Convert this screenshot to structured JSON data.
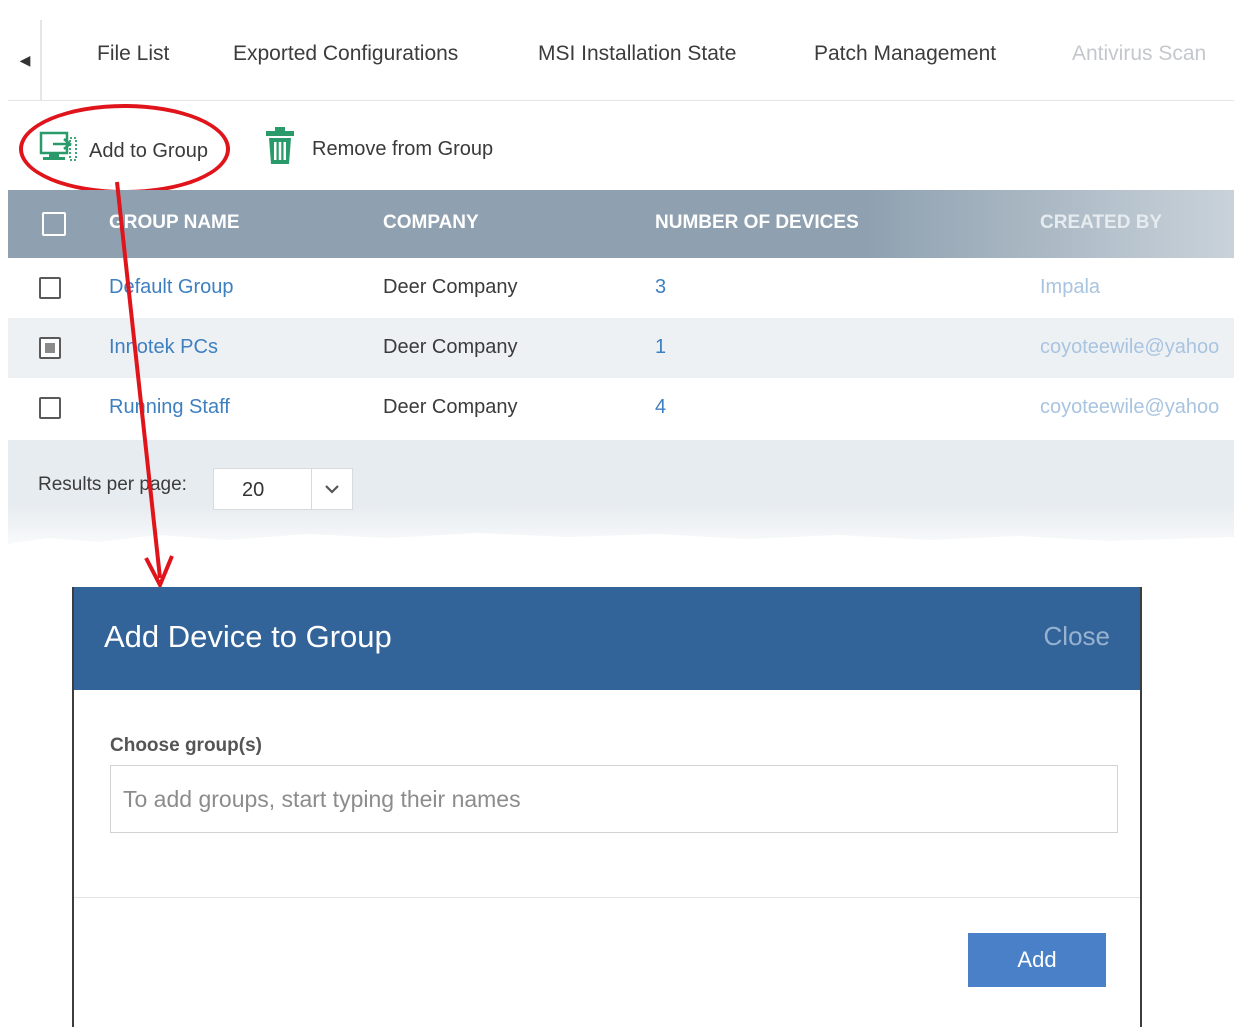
{
  "tabs": {
    "items": [
      {
        "label": "File List"
      },
      {
        "label": "Exported Configurations"
      },
      {
        "label": "MSI Installation State"
      },
      {
        "label": "Patch Management"
      },
      {
        "label": "Antivirus Scan"
      }
    ]
  },
  "toolbar": {
    "add_to_group_label": "Add to Group",
    "remove_from_group_label": "Remove from Group"
  },
  "table": {
    "headers": [
      "GROUP NAME",
      "COMPANY",
      "NUMBER OF DEVICES",
      "CREATED BY"
    ],
    "rows": [
      {
        "group_name": "Default Group",
        "company": "Deer Company",
        "devices": "3",
        "created_by": "Impala",
        "checked": false
      },
      {
        "group_name": "Innotek PCs",
        "company": "Deer Company",
        "devices": "1",
        "created_by": "coyoteewile@yahoo",
        "checked": true
      },
      {
        "group_name": "Running Staff",
        "company": "Deer Company",
        "devices": "4",
        "created_by": "coyoteewile@yahoo",
        "checked": false
      }
    ]
  },
  "pager": {
    "label": "Results per page:",
    "value": "20"
  },
  "dialog": {
    "title": "Add Device to Group",
    "close_label": "Close",
    "field_label": "Choose group(s)",
    "placeholder": "To add groups, start typing their names",
    "add_label": "Add"
  },
  "colors": {
    "header_blue": "#336499",
    "table_header": "#8fa1b0",
    "link": "#3d7fc1",
    "annotation_red": "#e0141b",
    "icon_green": "#2a9a6a"
  }
}
